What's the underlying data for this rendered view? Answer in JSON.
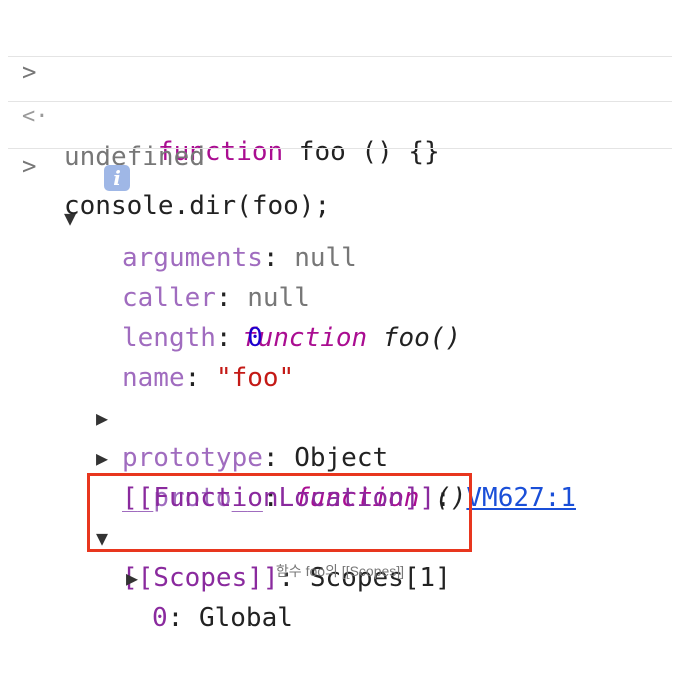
{
  "console": {
    "input1": {
      "prompt": ">",
      "keyword": "function",
      "rest": " foo () {}"
    },
    "output1": {
      "prompt": "<·",
      "value": "undefined"
    },
    "input2": {
      "prompt": ">",
      "code": "console.dir(foo);"
    },
    "dir": {
      "header": {
        "toggle": "▼",
        "info": "i",
        "keyword": "function",
        "name": " foo()"
      },
      "props": [
        {
          "key": "arguments",
          "sep": ": ",
          "value": "null",
          "type": "null"
        },
        {
          "key": "caller",
          "sep": ": ",
          "value": "null",
          "type": "null"
        },
        {
          "key": "length",
          "sep": ": ",
          "value": "0",
          "type": "num"
        },
        {
          "key": "name",
          "sep": ": ",
          "value": "\"foo\"",
          "type": "str"
        }
      ],
      "prototype": {
        "toggle": "▶",
        "key": "prototype",
        "sep": ": ",
        "value": "Object"
      },
      "proto": {
        "toggle": "▶",
        "key": "__proto__",
        "sep": ": ",
        "keyword": "function",
        "value": " ()"
      },
      "location": {
        "key": "[[FunctionLocation]]",
        "sep": ": ",
        "link": "VM627:1"
      },
      "scopes": {
        "toggle": "▼",
        "key": "[[Scopes]]",
        "sep": ": ",
        "value": "Scopes[1]"
      },
      "scope0": {
        "toggle": "▶",
        "key": "0",
        "sep": ": ",
        "value": "Global"
      }
    }
  },
  "caption": "함수 foo의 [[Scopes]]",
  "colors": {
    "highlight": "#e8361e",
    "keyword": "#aa0d91",
    "link": "#1a4fd8"
  }
}
